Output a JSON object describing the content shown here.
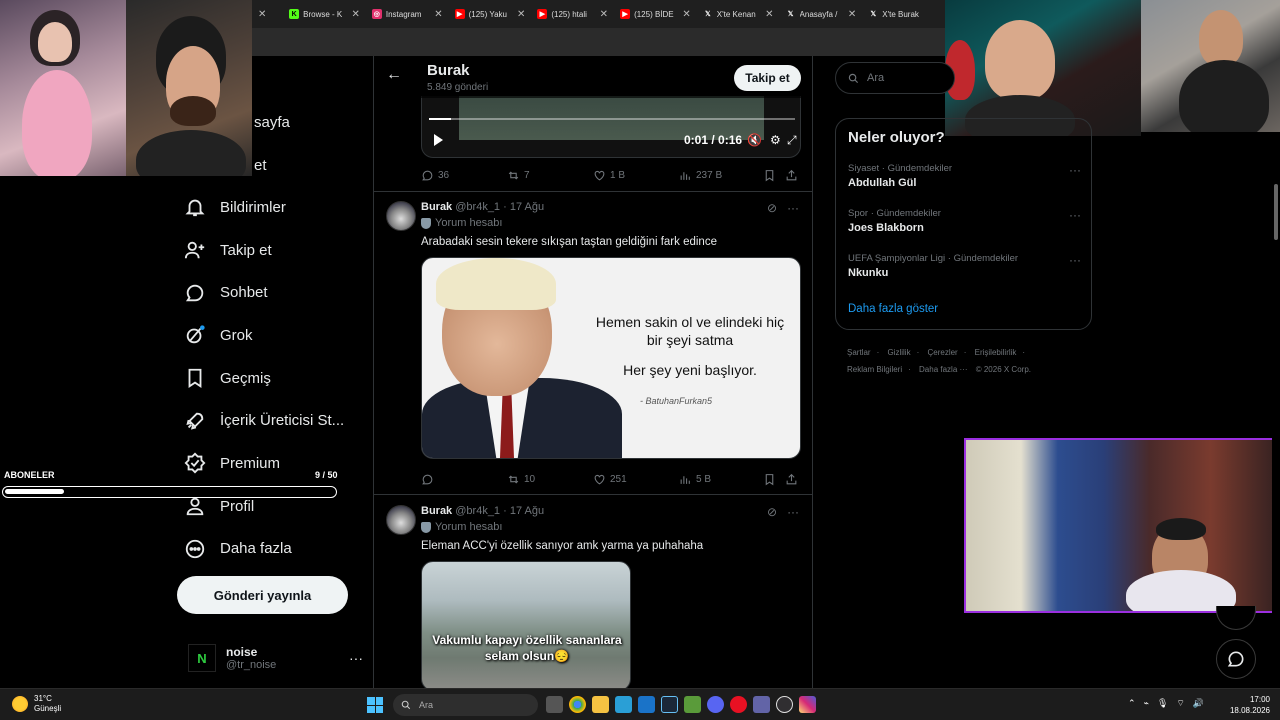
{
  "browser": {
    "tabs": [
      {
        "label": "Browse - K",
        "icon": "kick-icon",
        "color": "#53fc18",
        "fav": "K"
      },
      {
        "label": "Instagram",
        "icon": "instagram-icon",
        "color": "#e1306c",
        "fav": "◎"
      },
      {
        "label": "(125) Yaku",
        "icon": "youtube-icon",
        "color": "#ff0000",
        "fav": "▶"
      },
      {
        "label": "(125) htali",
        "icon": "youtube-icon",
        "color": "#ff0000",
        "fav": "▶"
      },
      {
        "label": "(125) BİDE",
        "icon": "youtube-icon",
        "color": "#ff0000",
        "fav": "▶"
      },
      {
        "label": "X'te Kenan",
        "icon": "x-icon",
        "color": "#000000",
        "fav": "𝕏"
      },
      {
        "label": "Anasayfa /",
        "icon": "x-icon",
        "color": "#000000",
        "fav": "𝕏"
      },
      {
        "label": "X'te Burak",
        "icon": "x-icon",
        "color": "#000000",
        "fav": "𝕏"
      }
    ]
  },
  "nav": {
    "partial_home": "sayfa",
    "partial_explore": "et",
    "items": [
      {
        "label": "Bildirimler",
        "icon": "bell-icon"
      },
      {
        "label": "Takip et",
        "icon": "follow-icon"
      },
      {
        "label": "Sohbet",
        "icon": "chat-icon"
      },
      {
        "label": "Grok",
        "icon": "grok-icon"
      },
      {
        "label": "Geçmiş",
        "icon": "bookmark-icon"
      },
      {
        "label": "İçerik Üreticisi St...",
        "icon": "rocket-icon"
      },
      {
        "label": "Premium",
        "icon": "premium-icon"
      },
      {
        "label": "Profil",
        "icon": "profile-icon"
      },
      {
        "label": "Daha fazla",
        "icon": "more-icon"
      }
    ],
    "post_button": "Gönderi yayınla",
    "account": {
      "name": "noise",
      "handle": "@tr_noise",
      "avatar_letter": "N"
    }
  },
  "overlay": {
    "subs_label": "ABONELER",
    "subs_count": "9 / 50",
    "subs_progress": 0.18
  },
  "profile_header": {
    "title": "Burak",
    "subtitle": "5.849 gönderi",
    "follow_label": "Takip et"
  },
  "video": {
    "time": "0:01 / 0:16",
    "progress": 0.06
  },
  "posts": [
    {
      "actions": {
        "replies": "36",
        "reposts": "7",
        "likes": "1 B",
        "views": "237 B"
      }
    },
    {
      "name": "Burak",
      "handle": "@br4k_1",
      "date": "· 17 Ağu",
      "badge": "Yorum hesabı",
      "text": "Arabadaki sesin tekere sıkışan taştan geldiğini fark edince",
      "image_quote_1": "Hemen sakin ol ve elindeki hiç bir şeyi satma",
      "image_quote_2": "Her şey yeni başlıyor.",
      "image_signature": "- BatuhanFurkan5",
      "actions": {
        "replies": "",
        "reposts": "10",
        "likes": "251",
        "views": "5 B"
      }
    },
    {
      "name": "Burak",
      "handle": "@br4k_1",
      "date": "· 17 Ağu",
      "badge": "Yorum hesabı",
      "text": "Eleman ACC'yi özellik sanıyor amk yarma ya puhahaha",
      "image_caption": "Vakumlu kapayı özellik sananlara selam olsun😔"
    }
  ],
  "sidebar": {
    "search_placeholder": "Ara",
    "trends_title": "Neler oluyor?",
    "trends": [
      {
        "category": "Siyaset · Gündemdekiler",
        "title": "Abdullah Gül"
      },
      {
        "category": "Spor · Gündemdekiler",
        "title": "Joes Blakborn"
      },
      {
        "category": "UEFA Şampiyonlar Ligi · Gündemdekiler",
        "title": "Nkunku"
      }
    ],
    "show_more": "Daha fazla göster",
    "footer": [
      "Şartlar",
      "·",
      "Gizlilik",
      "·",
      "Çerezler",
      "·",
      "Erişilebilirlik",
      "·",
      "Reklam Bilgileri",
      "·",
      "Daha fazla ···",
      "© 2026 X Corp."
    ]
  },
  "taskbar": {
    "weather_temp": "31°C",
    "weather_desc": "Güneşli",
    "search_placeholder": "Ara",
    "time": "17:00",
    "date": "18.08.2026"
  },
  "colors": {
    "accent": "#1d9bf0",
    "overlay_border": "#9b2fe0",
    "grok_dot": "#1d9bf0"
  }
}
